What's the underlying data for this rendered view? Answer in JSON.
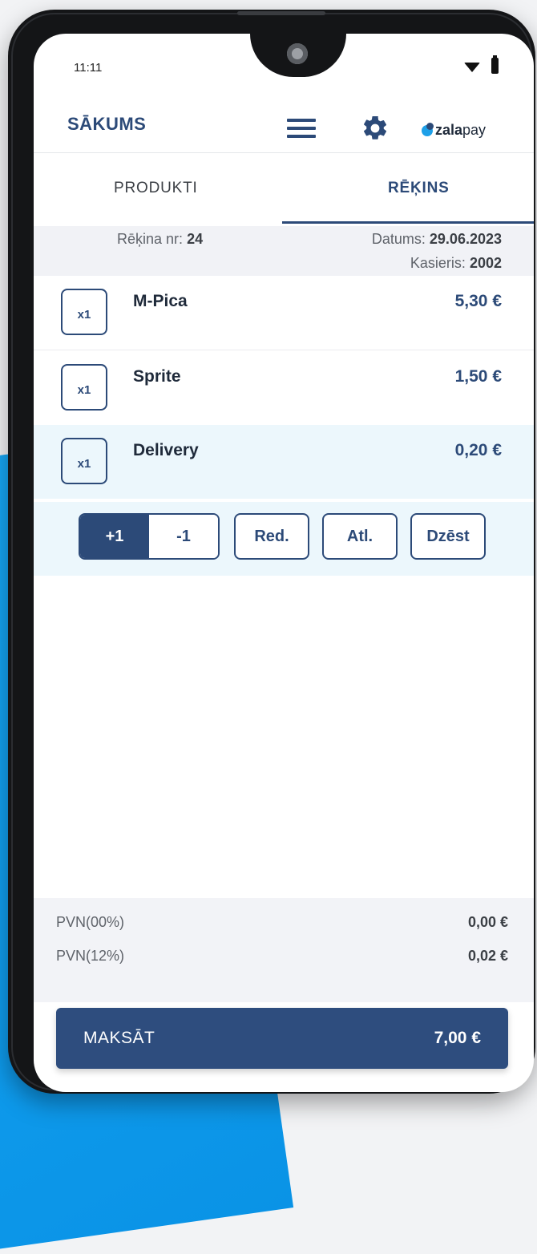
{
  "status_bar": {
    "time": "11:11",
    "wifi_icon": "wifi-icon",
    "battery_icon": "battery-icon"
  },
  "header": {
    "title": "SĀKUMS",
    "menu_icon": "menu-icon",
    "settings_icon": "gear-icon",
    "logo": {
      "bold": "zala",
      "light": "pay"
    }
  },
  "tabs": [
    {
      "label": "PRODUKTI",
      "active": false
    },
    {
      "label": "RĒĶINS",
      "active": true
    }
  ],
  "invoice": {
    "number_label": "Rēķina nr:",
    "number": "24",
    "date_label": "Datums:",
    "date": "29.06.2023",
    "cashier_label": "Kasieris:",
    "cashier": "2002"
  },
  "items": [
    {
      "qty": "x1",
      "name": "M-Pica",
      "price": "5,30 €",
      "selected": false
    },
    {
      "qty": "x1",
      "name": "Sprite",
      "price": "1,50 €",
      "selected": false
    },
    {
      "qty": "x1",
      "name": "Delivery",
      "price": "0,20 €",
      "selected": true
    }
  ],
  "actions": {
    "plus": "+1",
    "minus": "-1",
    "edit": "Red.",
    "discount": "Atl.",
    "delete": "Dzēst"
  },
  "vat": [
    {
      "label": "PVN(00%)",
      "value": "0,00 €"
    },
    {
      "label": "PVN(12%)",
      "value": "0,02 €"
    }
  ],
  "pay": {
    "label": "MAKSĀT",
    "total": "7,00 €"
  },
  "colors": {
    "primary": "#2c4a78",
    "accent_blue": "#1ea0e8",
    "selected_row": "#ecf7fc"
  }
}
